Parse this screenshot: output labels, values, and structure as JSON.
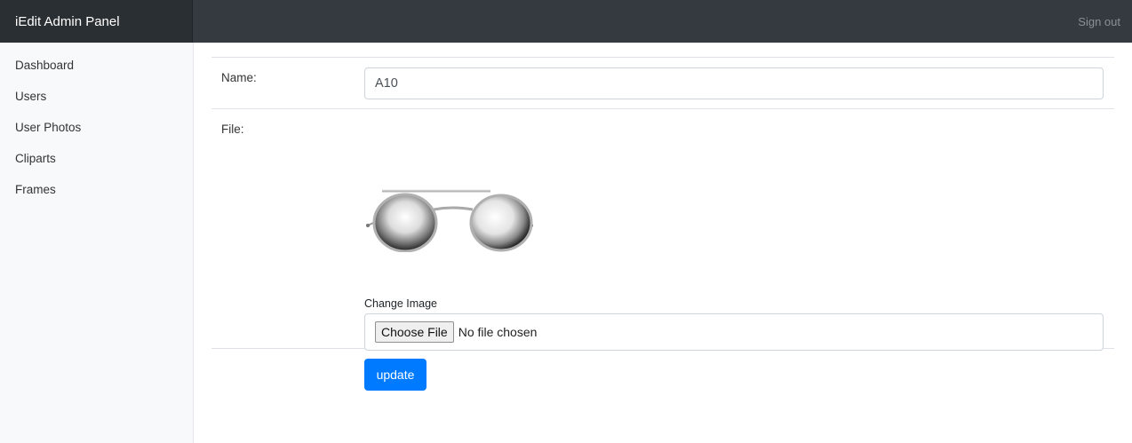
{
  "header": {
    "brand": "iEdit Admin Panel",
    "signout_label": "Sign out"
  },
  "sidebar": {
    "items": [
      {
        "label": "Dashboard"
      },
      {
        "label": "Users"
      },
      {
        "label": "User Photos"
      },
      {
        "label": "Cliparts"
      },
      {
        "label": "Frames"
      }
    ]
  },
  "form": {
    "name_label": "Name:",
    "name_value": "A10",
    "file_label": "File:",
    "change_image_label": "Change Image",
    "choose_file_label": "Choose File",
    "no_file_text": "No file chosen",
    "update_label": "update"
  },
  "colors": {
    "topbar": "#343a40",
    "primary": "#007bff"
  }
}
